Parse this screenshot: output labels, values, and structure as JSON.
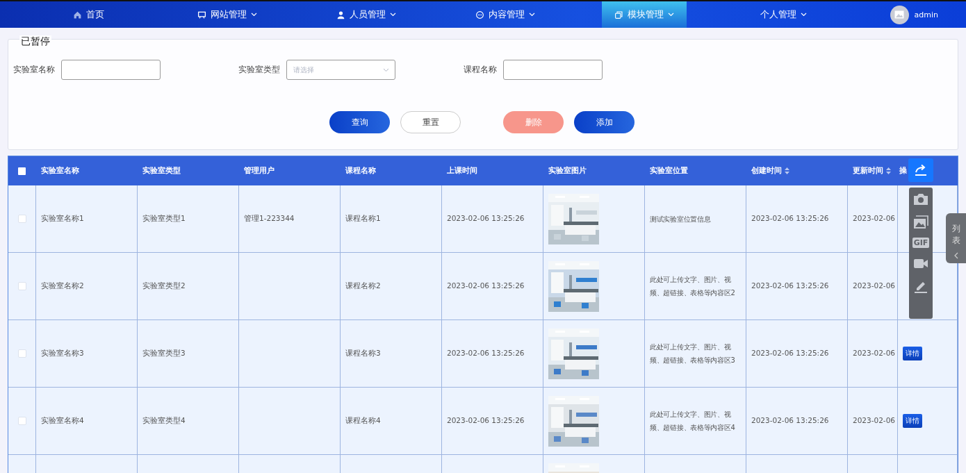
{
  "nav": {
    "items": [
      {
        "label": "首页",
        "has_menu": false,
        "selected": false
      },
      {
        "label": "网站管理",
        "has_menu": true,
        "selected": false
      },
      {
        "label": "人员管理",
        "has_menu": true,
        "selected": false
      },
      {
        "label": "内容管理",
        "has_menu": true,
        "selected": false
      },
      {
        "label": "模块管理",
        "has_menu": true,
        "selected": true
      },
      {
        "label": "个人管理",
        "has_menu": true,
        "selected": false
      }
    ],
    "user": {
      "name": "admin"
    }
  },
  "recorder_status": "已暂停",
  "search": {
    "fields": [
      {
        "label": "实验室名称",
        "kind": "text"
      },
      {
        "label": "实验室类型",
        "kind": "select",
        "placeholder": "请选择"
      },
      {
        "label": "课程名称",
        "kind": "text"
      }
    ],
    "buttons": [
      {
        "label": "查询",
        "kind": "primary"
      },
      {
        "label": "重置",
        "kind": "default"
      },
      {
        "label": "删除",
        "kind": "danger"
      },
      {
        "label": "添加",
        "kind": "primary"
      }
    ]
  },
  "table": {
    "header_checked": false,
    "columns": [
      {
        "label": "实验室名称"
      },
      {
        "label": "实验室类型"
      },
      {
        "label": "管理用户"
      },
      {
        "label": "课程名称"
      },
      {
        "label": "上课时间"
      },
      {
        "label": "实验室图片"
      },
      {
        "label": "实验室位置"
      },
      {
        "label": "创建时间",
        "sortable": true
      },
      {
        "label": "更新时间",
        "sortable": true
      },
      {
        "label": "操"
      }
    ],
    "rows": [
      {
        "checked": false,
        "cells": [
          "实验室名称1",
          "实验室类型1",
          "管理1-223344",
          "课程名称1",
          "2023-02-06 13:25:26",
          {
            "kind": "picture"
          },
          "测试实验室位置信息",
          "2023-02-06 13:25:26",
          "2023-02-06"
        ]
      },
      {
        "checked": false,
        "cells": [
          "实验室名称2",
          "实验室类型2",
          null,
          "课程名称2",
          "2023-02-06 13:25:26",
          {
            "kind": "picture"
          },
          "此处可上传文字、图片、视频、超链接、表格等内容区2",
          "2023-02-06 13:25:26",
          "2023-02-06"
        ]
      },
      {
        "checked": false,
        "cells": [
          "实验室名称3",
          "实验室类型3",
          null,
          "课程名称3",
          "2023-02-06 13:25:26",
          {
            "kind": "picture"
          },
          "此处可上传文字、图片、视频、超链接、表格等内容区3",
          "2023-02-06 13:25:26",
          "2023-02-06"
        ],
        "action": "详情"
      },
      {
        "checked": false,
        "cells": [
          "实验室名称4",
          "实验室类型4",
          null,
          "课程名称4",
          "2023-02-06 13:25:26",
          {
            "kind": "picture"
          },
          "此处可上传文字、图片、视频、超链接、表格等内容区4",
          "2023-02-06 13:25:26",
          "2023-02-06"
        ],
        "action": "详情"
      },
      {
        "cells": [
          null,
          null,
          null,
          null,
          null,
          {
            "kind": "picture"
          },
          null,
          null,
          null
        ]
      }
    ]
  },
  "capture_toolbar": {
    "gif_label": "GIF"
  },
  "side_tab": {
    "label": "列表"
  }
}
